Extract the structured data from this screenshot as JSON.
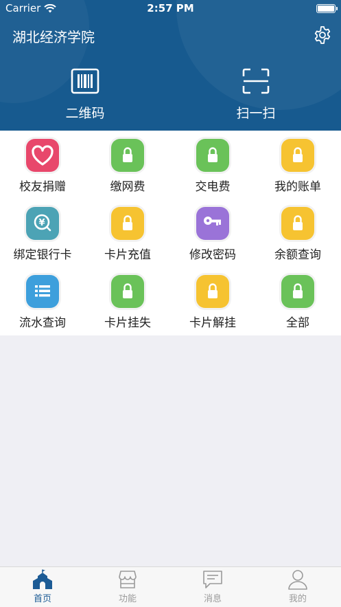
{
  "status_bar": {
    "carrier": "Carrier",
    "time": "2:57 PM"
  },
  "header": {
    "title": "湖北经济学院",
    "settings_icon": "gear-icon",
    "background": "#175a8f"
  },
  "quick_actions": [
    {
      "label": "二维码",
      "icon": "barcode-icon"
    },
    {
      "label": "扫一扫",
      "icon": "scan-icon"
    }
  ],
  "grid": [
    {
      "label": "校友捐赠",
      "icon": "heart-icon",
      "color": "#e8476b"
    },
    {
      "label": "缴网费",
      "icon": "lock-icon",
      "color": "#6ac259"
    },
    {
      "label": "交电费",
      "icon": "lock-icon",
      "color": "#6ac259"
    },
    {
      "label": "我的账单",
      "icon": "lock-icon",
      "color": "#f6c331"
    },
    {
      "label": "绑定银行卡",
      "icon": "yen-icon",
      "color": "#4ca3b5"
    },
    {
      "label": "卡片充值",
      "icon": "lock-icon",
      "color": "#f6c331"
    },
    {
      "label": "修改密码",
      "icon": "key-icon",
      "color": "#9a73d8"
    },
    {
      "label": "余额查询",
      "icon": "lock-icon",
      "color": "#f6c331"
    },
    {
      "label": "流水查询",
      "icon": "list-icon",
      "color": "#3d9fdc"
    },
    {
      "label": "卡片挂失",
      "icon": "lock-icon",
      "color": "#6ac259"
    },
    {
      "label": "卡片解挂",
      "icon": "lock-icon",
      "color": "#f6c331"
    },
    {
      "label": "全部",
      "icon": "lock-icon",
      "color": "#6ac259"
    }
  ],
  "tabbar": [
    {
      "label": "首页",
      "icon": "school-icon",
      "active": true
    },
    {
      "label": "功能",
      "icon": "store-icon",
      "active": false
    },
    {
      "label": "消息",
      "icon": "message-icon",
      "active": false
    },
    {
      "label": "我的",
      "icon": "person-icon",
      "active": false
    }
  ]
}
